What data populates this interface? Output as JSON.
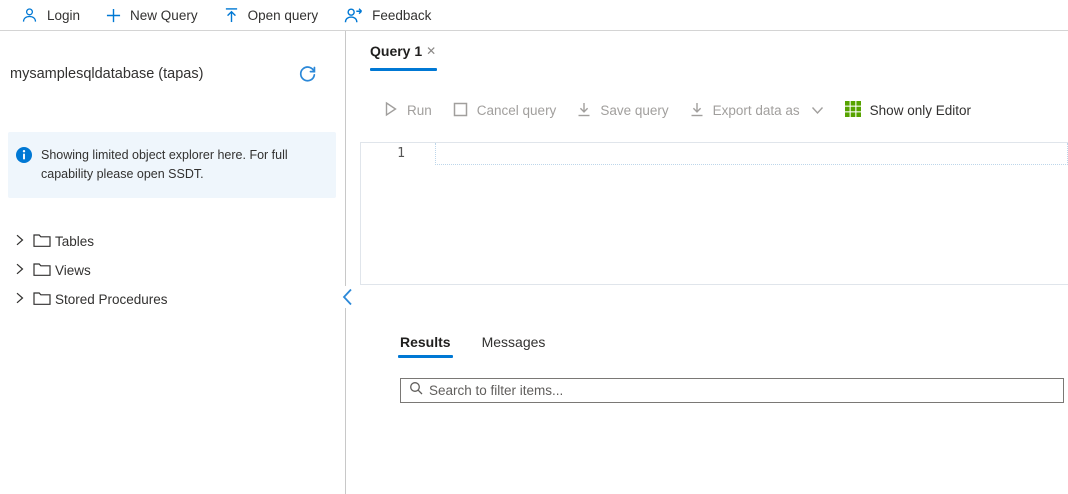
{
  "topbar": {
    "login_label": "Login",
    "new_query_label": "New Query",
    "open_query_label": "Open query",
    "feedback_label": "Feedback"
  },
  "sidebar": {
    "database_title": "mysamplesqldatabase (tapas)",
    "info_banner_text": "Showing limited object explorer here. For full capability please open SSDT.",
    "tree": [
      {
        "label": "Tables"
      },
      {
        "label": "Views"
      },
      {
        "label": "Stored Procedures"
      }
    ]
  },
  "main": {
    "tab": {
      "label": "Query 1",
      "close_glyph": "✕"
    },
    "toolbar": {
      "run_label": "Run",
      "cancel_label": "Cancel query",
      "save_label": "Save query",
      "export_label": "Export data as",
      "show_only_editor_label": "Show only Editor"
    },
    "editor": {
      "line_number": "1"
    },
    "results": {
      "results_tab_label": "Results",
      "messages_tab_label": "Messages",
      "search_placeholder": "Search to filter items..."
    }
  },
  "colors": {
    "accent_blue": "#0078d4",
    "disabled_gray": "#a19f9d",
    "grid_green": "#57a300",
    "banner_bg": "#eff6fc"
  }
}
